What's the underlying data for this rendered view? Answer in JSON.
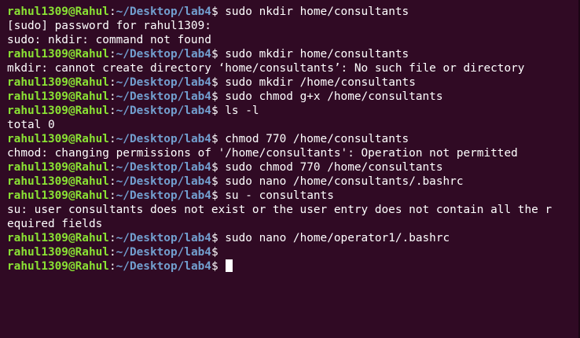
{
  "prompt": {
    "user": "rahul1309@Rahul",
    "separator": ":",
    "path": "~/Desktop/lab4",
    "symbol": "$ "
  },
  "lines": [
    {
      "type": "prompt",
      "command": "sudo nkdir home/consultants"
    },
    {
      "type": "output",
      "text": "[sudo] password for rahul1309:"
    },
    {
      "type": "output",
      "text": "sudo: nkdir: command not found"
    },
    {
      "type": "prompt",
      "command": "sudo mkdir home/consultants"
    },
    {
      "type": "output",
      "text": "mkdir: cannot create directory ‘home/consultants’: No such file or directory"
    },
    {
      "type": "prompt",
      "command": "sudo mkdir /home/consultants"
    },
    {
      "type": "prompt",
      "command": "sudo chmod g+x /home/consultants"
    },
    {
      "type": "prompt",
      "command": "ls -l"
    },
    {
      "type": "output",
      "text": "total 0"
    },
    {
      "type": "prompt",
      "command": "chmod 770 /home/consultants"
    },
    {
      "type": "output",
      "text": "chmod: changing permissions of '/home/consultants': Operation not permitted"
    },
    {
      "type": "prompt",
      "command": "sudo chmod 770 /home/consultants"
    },
    {
      "type": "prompt",
      "command": "sudo nano /home/consultants/.bashrc"
    },
    {
      "type": "prompt",
      "command": "su - consultants"
    },
    {
      "type": "output",
      "text": "su: user consultants does not exist or the user entry does not contain all the r"
    },
    {
      "type": "output",
      "text": "equired fields"
    },
    {
      "type": "prompt",
      "command": "sudo nano /home/operator1/.bashrc"
    },
    {
      "type": "prompt",
      "command": ""
    },
    {
      "type": "prompt",
      "command": "",
      "cursor": true
    }
  ],
  "colors": {
    "background": "#300a24",
    "user": "#8ae234",
    "path": "#729fcf",
    "text": "#ffffff"
  }
}
